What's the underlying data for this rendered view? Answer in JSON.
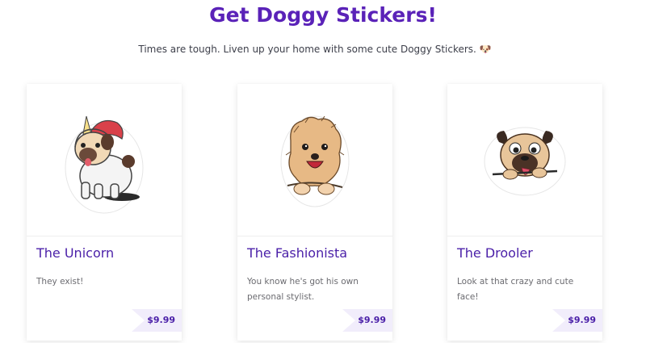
{
  "header": {
    "title": "Get Doggy Stickers!",
    "subtitle": "Times are tough. Liven up your home with some cute Doggy Stickers. 🐶"
  },
  "colors": {
    "title": "#5a22b8",
    "card_title": "#4a1fa8",
    "price_bg": "#f1edfb"
  },
  "cards": [
    {
      "title": "The Unicorn",
      "description": "They exist!",
      "price": "$9.99",
      "image_icon": "unicorn-pug-sticker"
    },
    {
      "title": "The Fashionista",
      "description": "You know he's got his own personal stylist.",
      "price": "$9.99",
      "image_icon": "fluffy-dog-sticker"
    },
    {
      "title": "The Drooler",
      "description": "Look at that crazy and cute face!",
      "price": "$9.99",
      "image_icon": "drooling-pug-sticker"
    }
  ]
}
